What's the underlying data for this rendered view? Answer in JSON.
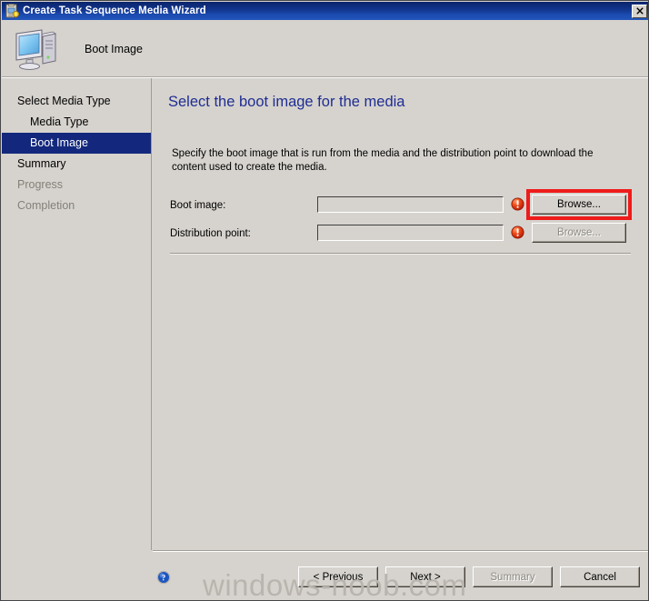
{
  "window": {
    "title": "Create Task Sequence Media Wizard",
    "title_icon": "wizard-media-icon",
    "close_label": "✕"
  },
  "header": {
    "icon": "computer-icon",
    "title": "Boot Image"
  },
  "sidebar": {
    "items": [
      {
        "label": "Select Media Type",
        "level": 0,
        "state": "normal"
      },
      {
        "label": "Media Type",
        "level": 1,
        "state": "normal"
      },
      {
        "label": "Boot Image",
        "level": 1,
        "state": "selected"
      },
      {
        "label": "Summary",
        "level": 0,
        "state": "normal"
      },
      {
        "label": "Progress",
        "level": 0,
        "state": "disabled"
      },
      {
        "label": "Completion",
        "level": 0,
        "state": "disabled"
      }
    ]
  },
  "content": {
    "heading": "Select the boot image for the media",
    "description": "Specify the boot image that is run from the media and the distribution point to download the content used to create the media.",
    "fields": [
      {
        "label": "Boot image:",
        "value": "",
        "error_icon": "error-icon",
        "button_label": "Browse...",
        "button_disabled": false,
        "highlighted": true
      },
      {
        "label": "Distribution point:",
        "value": "",
        "error_icon": "error-icon",
        "button_label": "Browse...",
        "button_disabled": true,
        "highlighted": false
      }
    ]
  },
  "footer": {
    "help_icon": "help-icon",
    "buttons": [
      {
        "label": "< Previous",
        "disabled": false
      },
      {
        "label": "Next >",
        "disabled": false
      },
      {
        "label": "Summary",
        "disabled": true
      },
      {
        "label": "Cancel",
        "disabled": false
      }
    ]
  },
  "watermark": "windows-noob.com",
  "colors": {
    "window_bg": "#d6d3ce",
    "titlebar_start": "#0a246a",
    "titlebar_end": "#2255bb",
    "selection": "#13287d",
    "heading": "#1f2d93",
    "highlight": "#ee1b1b",
    "disabled_text": "#8f8b84"
  }
}
